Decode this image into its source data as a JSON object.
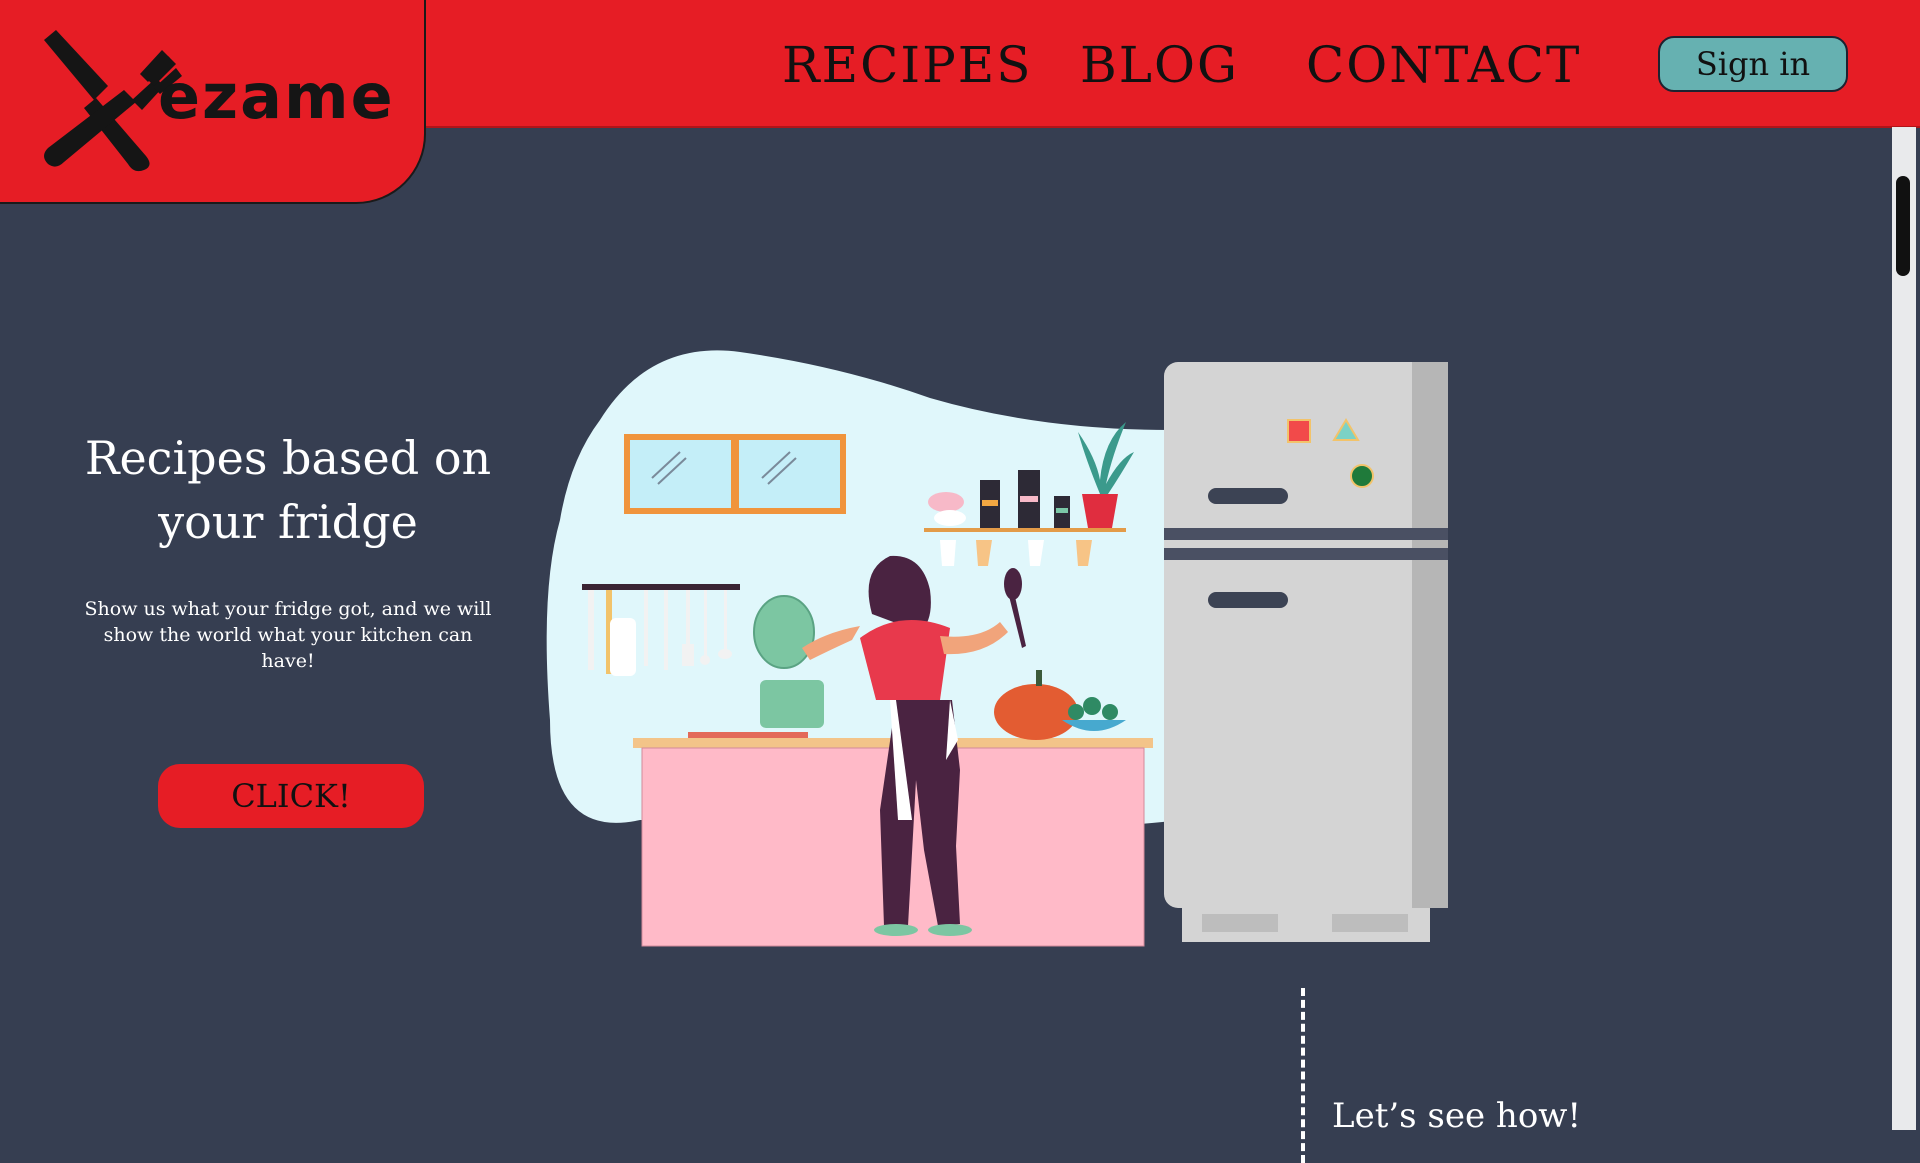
{
  "brand": {
    "logo_text": "ezame"
  },
  "nav": {
    "recipes": "RECIPES",
    "blog": "BLOG",
    "contact": "CONTACT",
    "signin": "Sign in"
  },
  "hero": {
    "title_line1": "Recipes based on",
    "title_line2": "your fridge",
    "subtitle_line1": "Show us what your fridge got, and we will",
    "subtitle_line2": "show the world what your kitchen can have!",
    "cta": "CLICK!"
  },
  "section": {
    "see_how": "Let’s see how!"
  },
  "colors": {
    "header": "#e61d25",
    "background": "#363e51",
    "signin": "#66b1b1",
    "cta": "#e61d25"
  }
}
